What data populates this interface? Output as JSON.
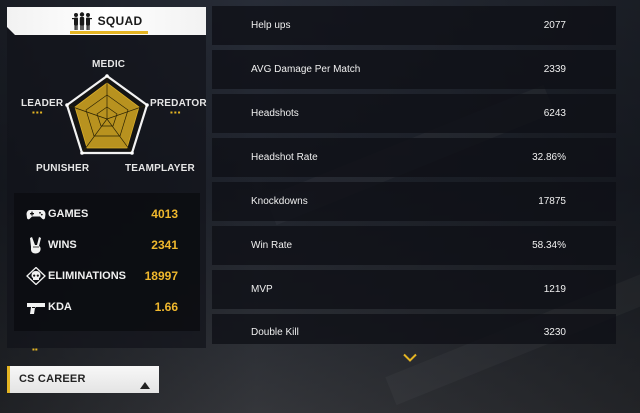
{
  "squad": {
    "title": "SQUAD",
    "icon": "squad-silhouette-icon"
  },
  "radar": {
    "labels": {
      "top": "MEDIC",
      "left": "LEADER",
      "right": "PREDATOR",
      "bottom_left": "PUNISHER",
      "bottom_right": "TEAMPLAYER"
    },
    "fill_color": "#b8921f",
    "accent_color": "#e5b523"
  },
  "summary": [
    {
      "icon": "gamepad-icon",
      "label": "GAMES",
      "value": "4013"
    },
    {
      "icon": "victory-hand-icon",
      "label": "WINS",
      "value": "2341"
    },
    {
      "icon": "elimination-skull-icon",
      "label": "ELIMINATIONS",
      "value": "18997"
    },
    {
      "icon": "pistol-icon",
      "label": "KDA",
      "value": "1.66"
    }
  ],
  "details": [
    {
      "label": "Help ups",
      "value": "2077"
    },
    {
      "label": "AVG Damage Per Match",
      "value": "2339"
    },
    {
      "label": "Headshots",
      "value": "6243"
    },
    {
      "label": "Headshot Rate",
      "value": "32.86%"
    },
    {
      "label": "Knockdowns",
      "value": "17875"
    },
    {
      "label": "Win Rate",
      "value": "58.34%"
    },
    {
      "label": "MVP",
      "value": "1219"
    },
    {
      "label": "Double Kill",
      "value": "3230"
    }
  ],
  "career_dropdown": {
    "label": "CS CAREER",
    "arrow_icon": "caret-up-icon"
  },
  "colors": {
    "accent": "#e5b523",
    "value_gold": "#f0b82d"
  }
}
